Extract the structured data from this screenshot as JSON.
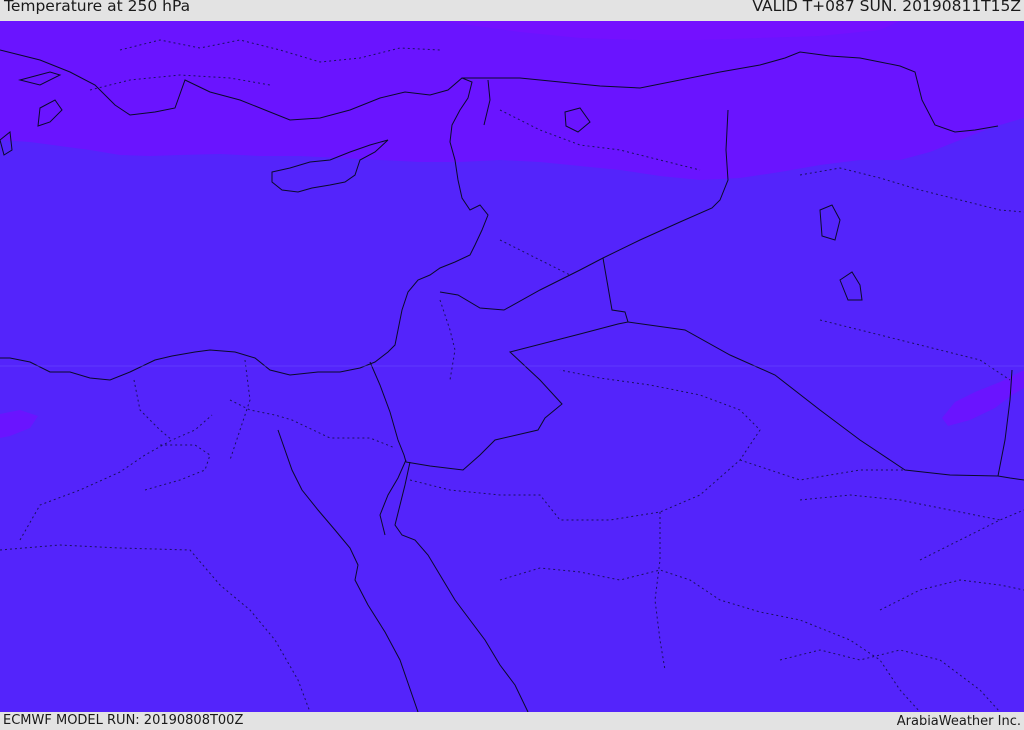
{
  "header": {
    "title": "Temperature at 250 hPa",
    "valid": "VALID T+087 SUN. 20190811T15Z"
  },
  "footer": {
    "model_run": "ECMWF MODEL RUN: 20190808T00Z",
    "brand": "ArabiaWeather Inc."
  },
  "map": {
    "colors": {
      "base_fill": "#5424fb",
      "cold_band_fill": "#6a14ff",
      "borders": "#0a0a2a"
    }
  }
}
